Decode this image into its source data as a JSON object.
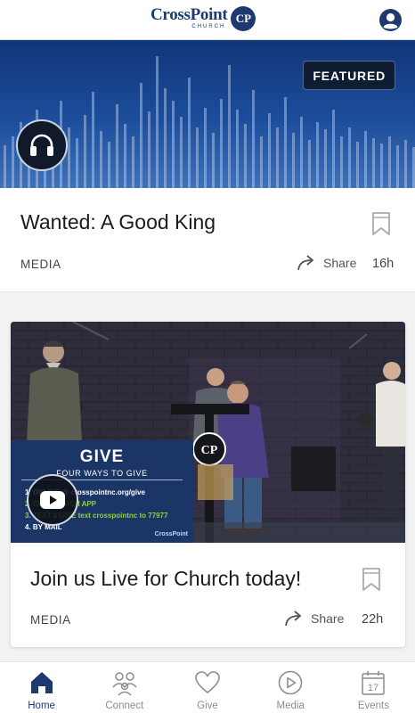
{
  "header": {
    "logo_name": "CrossPoint",
    "logo_sub": "CHURCH",
    "logo_badge": "CP",
    "profile_icon": "user-circle-icon"
  },
  "featured": {
    "badge": "FEATURED",
    "title": "Wanted: A Good King",
    "category": "MEDIA",
    "share_label": "Share",
    "age": "16h",
    "media_icon": "headphones-icon"
  },
  "post": {
    "title": "Join us Live for Church today!",
    "category": "MEDIA",
    "share_label": "Share",
    "age": "22h",
    "slide": {
      "title": "GIVE",
      "subtitle": "FOUR WAYS TO GIVE",
      "items": [
        "1. ONLINE @ crosspointnc.org/give",
        "2. CP - CHURCH APP",
        "3. TEXT 2 GIVE text crosspointnc to 77977",
        "4. BY MAIL"
      ],
      "logo": "CrossPoint",
      "badge": "CP"
    }
  },
  "nav": {
    "items": [
      {
        "label": "Home",
        "icon": "home-icon",
        "active": true
      },
      {
        "label": "Connect",
        "icon": "people-icon",
        "active": false
      },
      {
        "label": "Give",
        "icon": "heart-icon",
        "active": false
      },
      {
        "label": "Media",
        "icon": "play-circle-icon",
        "active": false
      },
      {
        "label": "Events",
        "icon": "calendar-icon",
        "active": false
      }
    ],
    "calendar_day": "17"
  },
  "colors": {
    "brand": "#1c3a6e",
    "hero_top": "#11357a",
    "hero_bottom": "#3f71b9",
    "give_green": "#8dd33b"
  }
}
